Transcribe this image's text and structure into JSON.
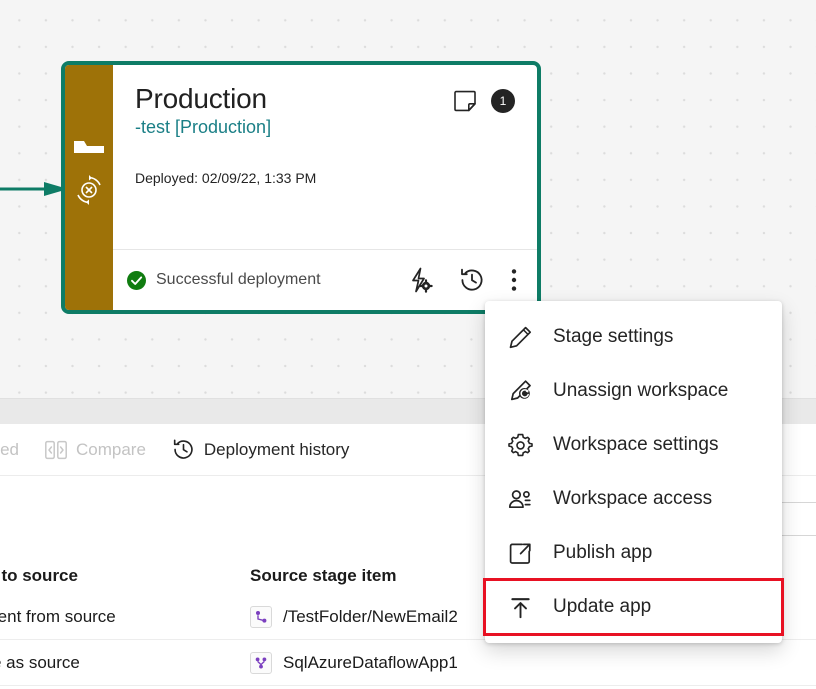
{
  "card": {
    "title": "Production",
    "workspace_link": "-test [Production]",
    "note_icon": "sticky-note-icon",
    "note_badge_count": "1",
    "deployed_label": "Deployed: 02/09/22, 1:33 PM",
    "status_text": "Successful deployment",
    "status_icon": "success-check-circle-icon",
    "rail_stage_icon": "stage-flag-icon",
    "rail_status_icon": "unassigned-refresh-x-icon",
    "footer_icons": [
      {
        "name": "deployment-rules-icon"
      },
      {
        "name": "deployment-history-icon"
      },
      {
        "name": "more-options-icon"
      }
    ],
    "border_color": "#0e7c66",
    "rail_color": "#9e7208",
    "link_color": "#1a7f86",
    "success_color": "#107c10"
  },
  "toolbar": {
    "items": [
      {
        "label": "related",
        "icon": "",
        "enabled": false
      },
      {
        "label": "Compare",
        "icon": "compare-icon",
        "enabled": false
      },
      {
        "label": "Deployment history",
        "icon": "history-icon",
        "enabled": true
      }
    ]
  },
  "table": {
    "headers": [
      "l to source",
      "Source stage item"
    ],
    "rows": [
      {
        "compared": "rent from source",
        "item_icon": "dataflow-item-icon",
        "item_name": "/TestFolder/NewEmail2"
      },
      {
        "compared": "e as source",
        "item_icon": "dataflow-item-icon",
        "item_name": "SqlAzureDataflowApp1"
      }
    ]
  },
  "context_menu": {
    "items": [
      {
        "label": "Stage settings",
        "icon": "pencil-icon",
        "highlighted": false
      },
      {
        "label": "Unassign workspace",
        "icon": "unassign-workspace-icon",
        "highlighted": false
      },
      {
        "label": "Workspace settings",
        "icon": "gear-icon",
        "highlighted": false
      },
      {
        "label": "Workspace access",
        "icon": "people-icon",
        "highlighted": false
      },
      {
        "label": "Publish app",
        "icon": "open-external-icon",
        "highlighted": false
      },
      {
        "label": "Update app",
        "icon": "upload-arrow-icon",
        "highlighted": true
      }
    ],
    "highlight_color": "#e81123"
  }
}
